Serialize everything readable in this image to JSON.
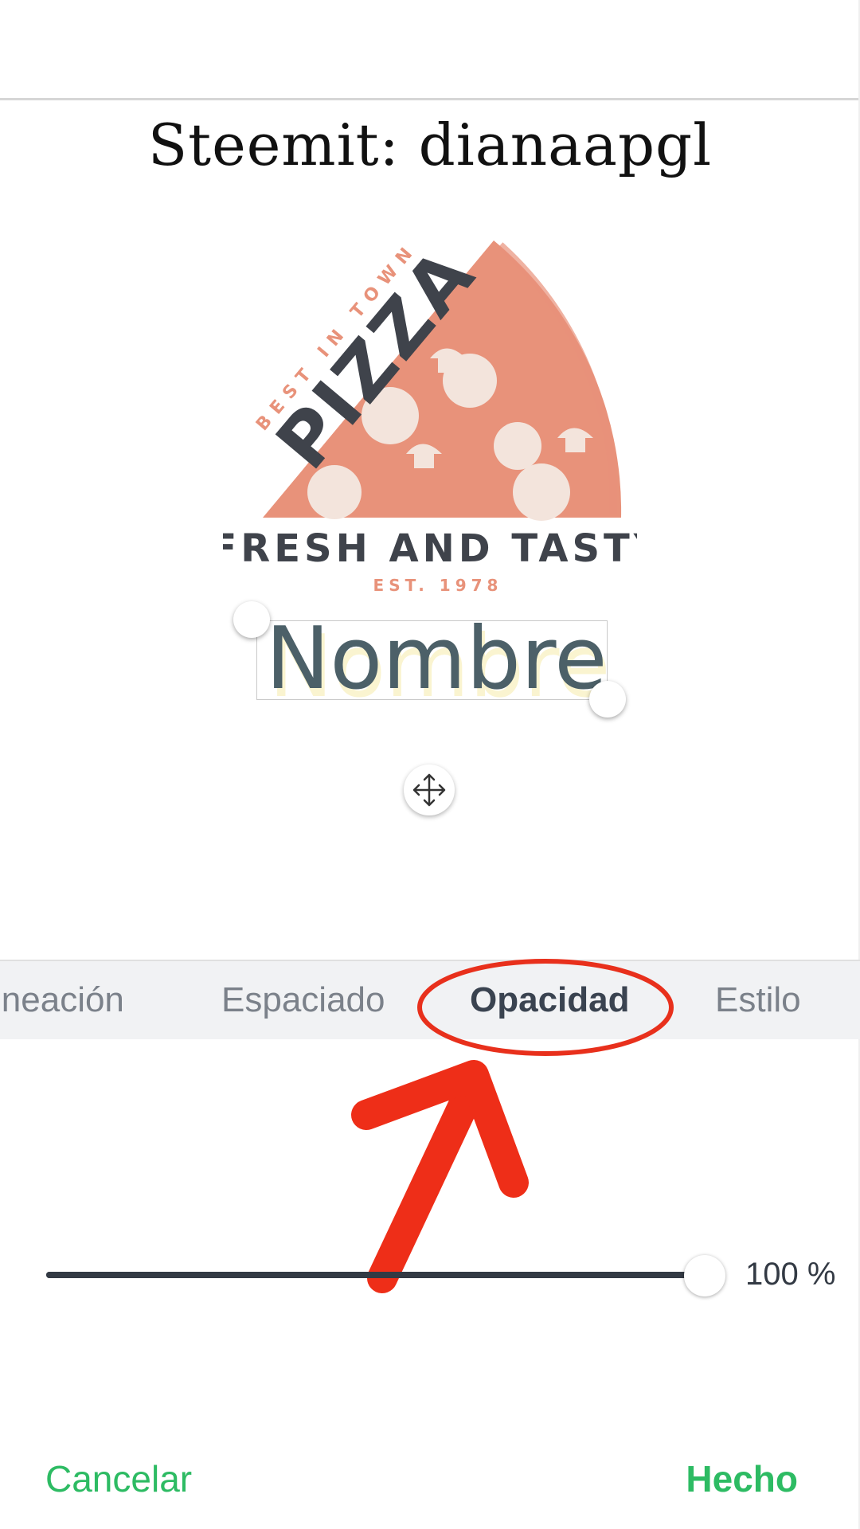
{
  "canvas": {
    "title": "Steemit: dianaapgl",
    "text_layer": "Nombre"
  },
  "logo": {
    "arc_text": "BEST IN TOWN",
    "brand_text": "PIZZA",
    "tagline": "FRESH AND TASTY",
    "established": "EST.  1978",
    "colors": {
      "slice": "#e8927a",
      "text": "#3f434b",
      "accent": "#e8927a"
    }
  },
  "tabs": [
    {
      "label": "ineación",
      "active": false
    },
    {
      "label": "Espaciado",
      "active": false
    },
    {
      "label": "Opacidad",
      "active": true
    },
    {
      "label": "Estilo",
      "active": false
    }
  ],
  "opacity": {
    "value_label": "100 %",
    "value": 1.0
  },
  "footer": {
    "cancel_label": "Cancelar",
    "done_label": "Hecho"
  },
  "annotation": {
    "color": "#e8301c"
  }
}
